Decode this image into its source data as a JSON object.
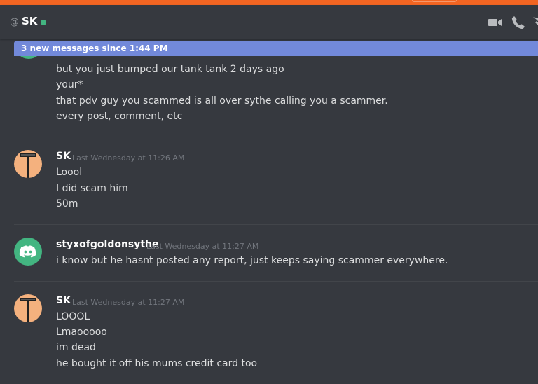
{
  "header": {
    "at_symbol": "@",
    "username": "SK",
    "status_color": "#43b581",
    "icons": [
      "video-call-icon",
      "voice-call-icon",
      "pinned-messages-icon"
    ]
  },
  "new_messages_bar": {
    "text": "3 new messages since 1:44 PM"
  },
  "continued_group": {
    "lines": [
      "but you just bumped our tank tank 2 days ago",
      "your*",
      "that pdv guy you scammed is all over sythe calling you a scammer.",
      "every post, comment, etc"
    ]
  },
  "messages": [
    {
      "author": "SK",
      "timestamp": "Last Wednesday at 11:26 AM",
      "lines": [
        "Loool",
        "I did scam him",
        "50m"
      ]
    },
    {
      "author": "styxofgoldonsythe",
      "timestamp": "Last Wednesday at 11:27 AM",
      "lines": [
        "i know but he hasnt posted any report, just keeps saying scammer everywhere."
      ]
    },
    {
      "author": "SK",
      "timestamp": "Last Wednesday at 11:27 AM",
      "lines": [
        "LOOOL",
        "Lmaooooo",
        "im dead",
        "he bought it off his mums credit card too"
      ]
    }
  ],
  "colors": {
    "background": "#36393f",
    "accent_bar": "#f26522",
    "new_messages": "#7289da",
    "text": "#dcddde",
    "timestamp": "#72767d"
  }
}
